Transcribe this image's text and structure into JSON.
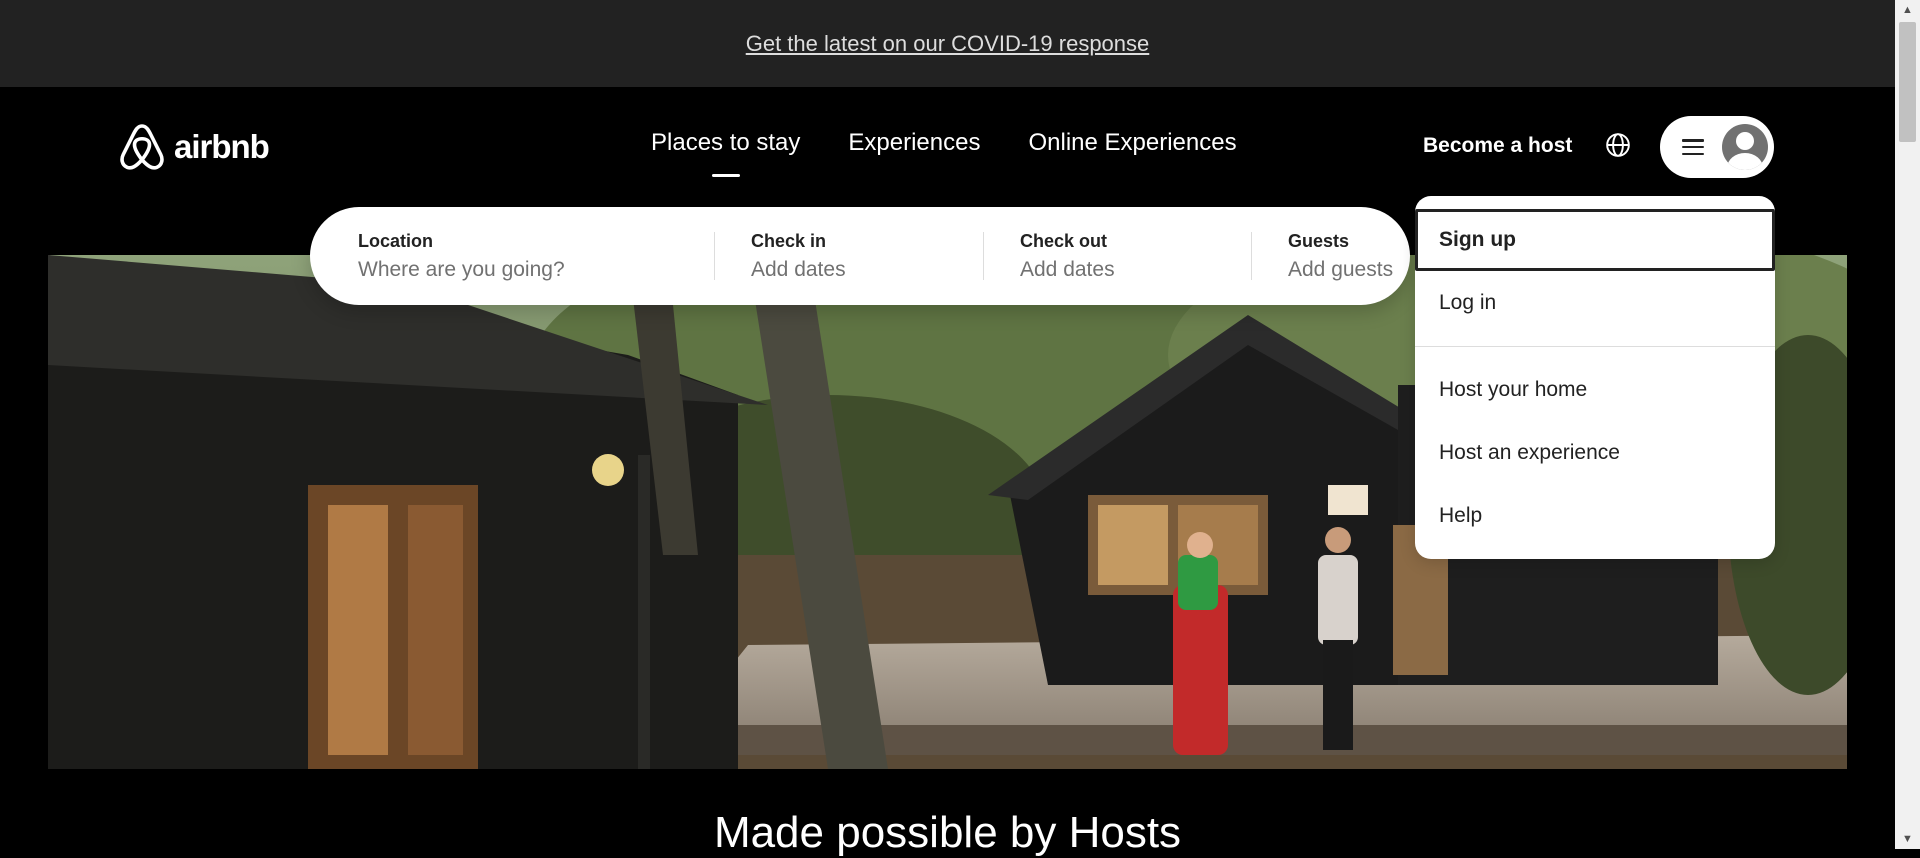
{
  "banner": {
    "link_text": "Get the latest on our COVID-19 response"
  },
  "header": {
    "logo_text": "airbnb",
    "nav": [
      {
        "label": "Places to stay",
        "active": true
      },
      {
        "label": "Experiences",
        "active": false
      },
      {
        "label": "Online Experiences",
        "active": false
      }
    ],
    "become_host": "Become a host"
  },
  "search": {
    "location": {
      "label": "Location",
      "placeholder": "Where are you going?"
    },
    "check_in": {
      "label": "Check in",
      "placeholder": "Add dates"
    },
    "check_out": {
      "label": "Check out",
      "placeholder": "Add dates"
    },
    "guests": {
      "label": "Guests",
      "placeholder": "Add guests"
    }
  },
  "menu": {
    "items": [
      "Sign up",
      "Log in",
      "Host your home",
      "Host an experience",
      "Help"
    ]
  },
  "heading": "Made possible by Hosts",
  "colors": {
    "banner_bg": "#222222",
    "page_bg": "#000000",
    "text_muted": "#717171"
  },
  "icons": [
    "airbnb-logo-icon",
    "globe-icon",
    "hamburger-icon",
    "avatar-icon"
  ]
}
